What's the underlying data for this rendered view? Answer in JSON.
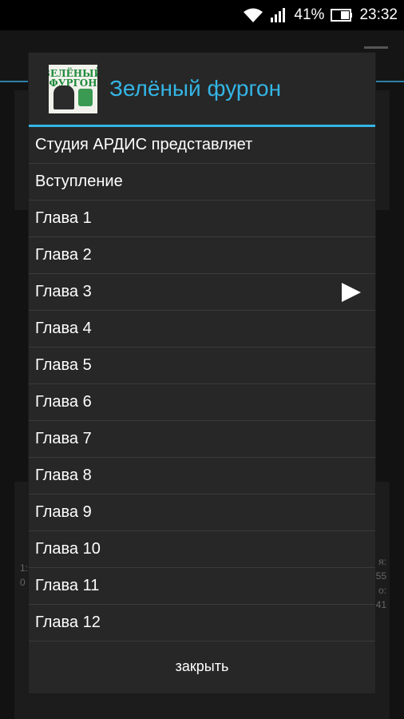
{
  "status_bar": {
    "battery_percent": "41%",
    "time": "23:32"
  },
  "background": {
    "left_text": "1:\n0",
    "right_text": "я:\n55\no:\n41"
  },
  "dialog": {
    "title": "Зелёный фургон",
    "cover_text_line1": "ЗЕЛЁНЫЙ",
    "cover_text_line2": "ФУРГОН",
    "items": [
      {
        "label": "Студия АРДИС представляет"
      },
      {
        "label": "Вступление"
      },
      {
        "label": "Глава 1"
      },
      {
        "label": "Глава 2"
      },
      {
        "label": "Глава 3",
        "playing": true
      },
      {
        "label": "Глава 4"
      },
      {
        "label": "Глава 5"
      },
      {
        "label": "Глава 6"
      },
      {
        "label": "Глава 7"
      },
      {
        "label": "Глава 8"
      },
      {
        "label": "Глава 9"
      },
      {
        "label": "Глава 10"
      },
      {
        "label": "Глава 11"
      },
      {
        "label": "Глава 12"
      }
    ],
    "close_label": "закрыть"
  },
  "colors": {
    "accent": "#33b5e5",
    "dialog_bg": "#272727",
    "divider": "#3b3b3b"
  }
}
